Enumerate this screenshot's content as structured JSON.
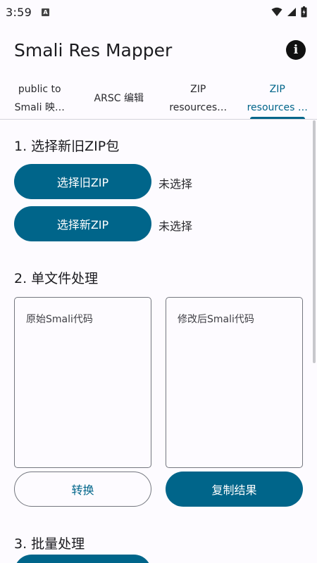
{
  "status": {
    "time": "3:59",
    "notif_icon": "A"
  },
  "app": {
    "title": "Smali Res Mapper",
    "info_icon": "i"
  },
  "tabs": [
    {
      "line1": "public to",
      "line2": "Smali 映…",
      "active": false
    },
    {
      "label": "ARSC 编辑",
      "active": false
    },
    {
      "line1": "ZIP",
      "line2": "resources…",
      "active": false
    },
    {
      "line1": "ZIP",
      "line2": "resources …",
      "active": true
    }
  ],
  "section1": {
    "title": "1. 选择新旧ZIP包",
    "old_zip_button": "选择旧ZIP",
    "old_zip_status": "未选择",
    "new_zip_button": "选择新ZIP",
    "new_zip_status": "未选择"
  },
  "section2": {
    "title": "2. 单文件处理",
    "original_placeholder": "原始Smali代码",
    "modified_placeholder": "修改后Smali代码",
    "convert_button": "转换",
    "copy_button": "复制结果"
  },
  "section3": {
    "title": "3. 批量处理"
  },
  "colors": {
    "accent": "#00658a",
    "background": "#fdfbff"
  }
}
